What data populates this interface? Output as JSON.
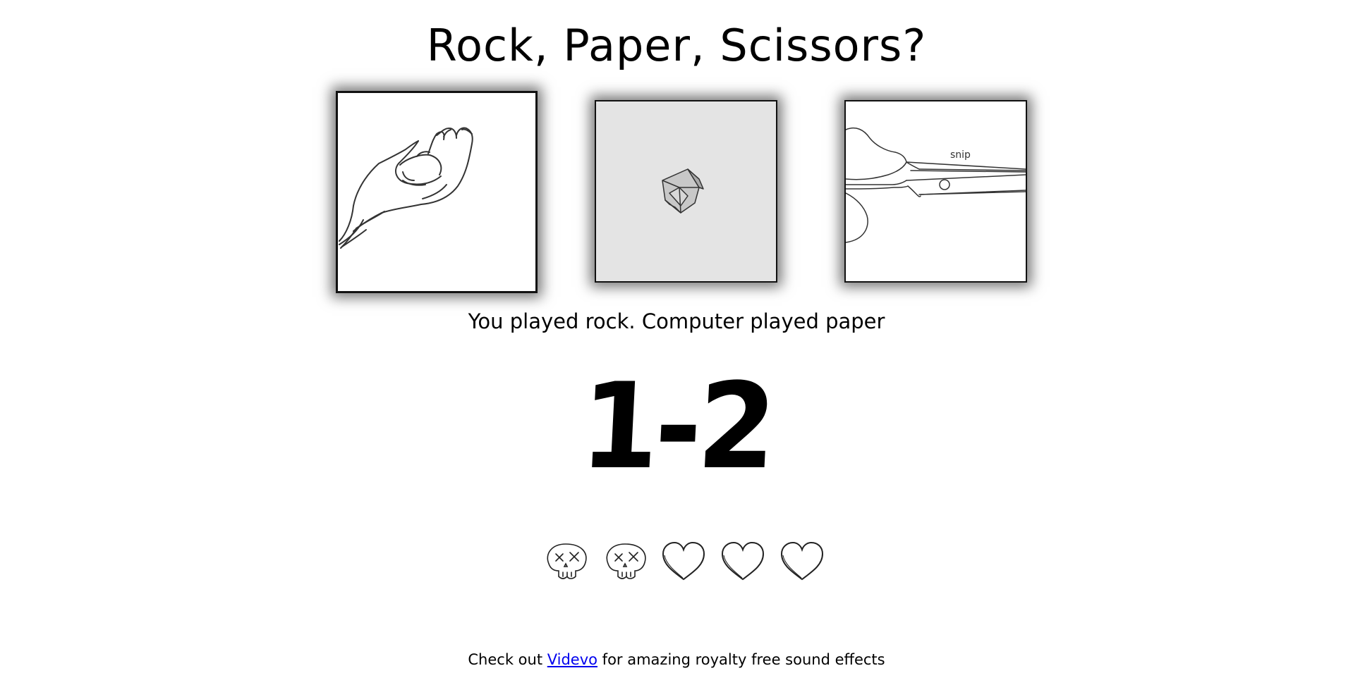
{
  "title": "Rock, Paper, Scissors?",
  "choices": [
    {
      "name": "rock",
      "selected": true
    },
    {
      "name": "paper",
      "selected": false
    },
    {
      "name": "scissors",
      "selected": false,
      "caption": "snip"
    }
  ],
  "result_text": "You played rock. Computer played paper",
  "score": {
    "text": "1-2",
    "player": 1,
    "computer": 2
  },
  "lives": [
    "skull-icon",
    "skull-icon",
    "heart-icon",
    "heart-icon",
    "heart-icon"
  ],
  "footer": {
    "before": "Check out ",
    "link": "Videvo",
    "after": " for amazing royalty free sound effects"
  },
  "colors": {
    "background": "#ffffff",
    "text": "#000000",
    "link": "#0000ee"
  }
}
